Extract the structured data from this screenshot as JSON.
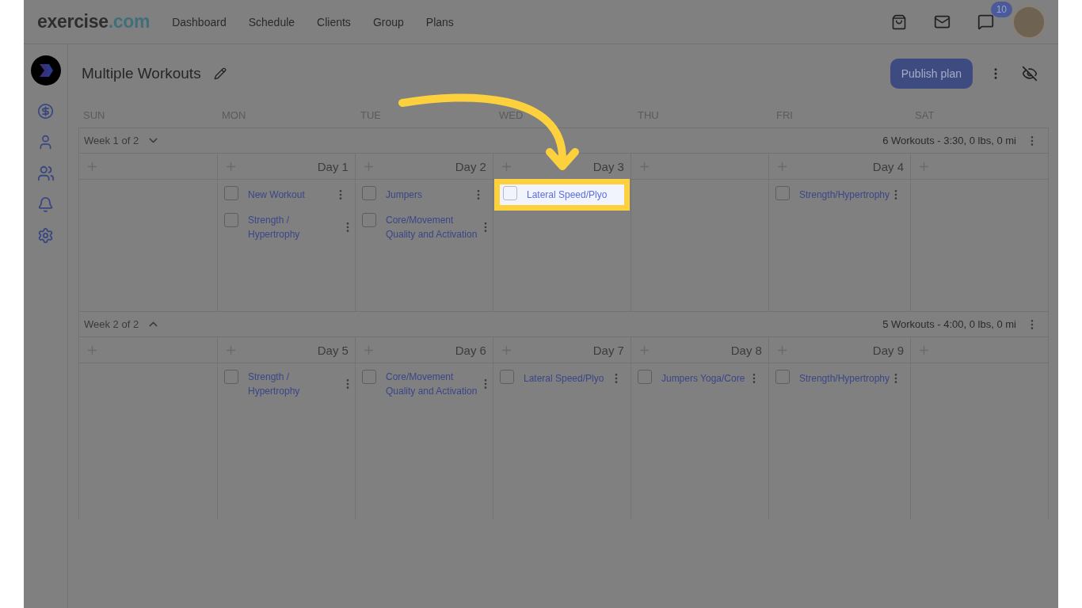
{
  "brand": {
    "name": "exercise",
    "tld": ".com"
  },
  "nav": [
    {
      "label": "Dashboard"
    },
    {
      "label": "Schedule"
    },
    {
      "label": "Clients"
    },
    {
      "label": "Group"
    },
    {
      "label": "Plans"
    }
  ],
  "message_badge": "10",
  "title": "Multiple Workouts",
  "publish_button": "Publish plan",
  "weekdays": [
    "SUN",
    "MON",
    "TUE",
    "WED",
    "THU",
    "FRI",
    "SAT"
  ],
  "weeks": [
    {
      "label": "Week 1 of 2",
      "expanded": false,
      "summary": "6 Workouts - 3:30, 0 lbs, 0 mi",
      "days": [
        {
          "kind": "open"
        },
        {
          "kind": "planned",
          "day_label": "Day 1",
          "workouts": [
            {
              "name": "New Workout",
              "checked": false,
              "highlighted": false
            },
            {
              "name": "Strength / Hypertrophy",
              "checked": false,
              "highlighted": false
            }
          ]
        },
        {
          "kind": "planned",
          "day_label": "Day 2",
          "workouts": [
            {
              "name": "Jumpers",
              "checked": false,
              "highlighted": false
            },
            {
              "name": "Core/Movement Quality and Activation",
              "checked": false,
              "highlighted": false
            }
          ]
        },
        {
          "kind": "planned",
          "day_label": "Day 3",
          "workouts": [
            {
              "name": "Lateral Speed/Plyo",
              "checked": false,
              "highlighted": true
            }
          ]
        },
        {
          "kind": "open"
        },
        {
          "kind": "planned",
          "day_label": "Day 4",
          "workouts": [
            {
              "name": "Strength/Hypertrophy",
              "checked": false,
              "highlighted": false
            }
          ]
        },
        {
          "kind": "open"
        }
      ]
    },
    {
      "label": "Week 2 of 2",
      "expanded": true,
      "summary": "5 Workouts - 4:00, 0 lbs, 0 mi",
      "days": [
        {
          "kind": "open"
        },
        {
          "kind": "planned",
          "day_label": "Day 5",
          "workouts": [
            {
              "name": "Strength / Hypertrophy",
              "checked": false,
              "highlighted": false
            }
          ]
        },
        {
          "kind": "planned",
          "day_label": "Day 6",
          "workouts": [
            {
              "name": "Core/Movement Quality and Activation",
              "checked": false,
              "highlighted": false
            }
          ]
        },
        {
          "kind": "planned",
          "day_label": "Day 7",
          "workouts": [
            {
              "name": "Lateral Speed/Plyo",
              "checked": false,
              "highlighted": false
            }
          ]
        },
        {
          "kind": "planned",
          "day_label": "Day 8",
          "workouts": [
            {
              "name": "Jumpers Yoga/Core",
              "checked": false,
              "highlighted": false
            }
          ]
        },
        {
          "kind": "planned",
          "day_label": "Day 9",
          "workouts": [
            {
              "name": "Strength/Hypertrophy",
              "checked": false,
              "highlighted": false
            }
          ]
        },
        {
          "kind": "open"
        }
      ]
    }
  ]
}
